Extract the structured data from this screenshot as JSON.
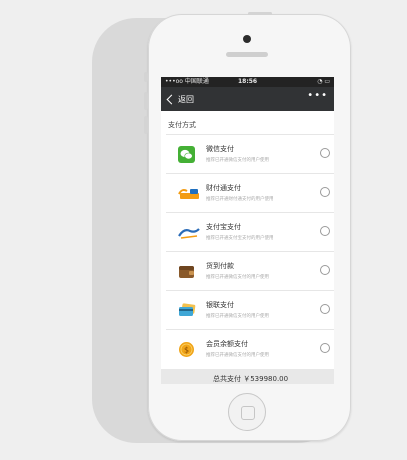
{
  "status_bar": {
    "carrier": "•••oo 中国联通",
    "time": "18:56",
    "indicators": "◔ ▭"
  },
  "nav": {
    "back_label": "返回",
    "more_label": "•••"
  },
  "section_title": "支付方式",
  "payment_methods": [
    {
      "title": "微信支付",
      "description": "推荐已开通微信支付的用户使用",
      "icon": "wechat-pay-icon",
      "color": "#44b035"
    },
    {
      "title": "财付通支付",
      "description": "推荐已开通财付通支付的用户使用",
      "icon": "tenpay-icon",
      "color": "#f39c12"
    },
    {
      "title": "支付宝支付",
      "description": "推荐已开通支付宝支付的用户使用",
      "icon": "alipay-icon",
      "color": "#2a6bb7"
    },
    {
      "title": "货到付款",
      "description": "推荐已开通微信支付的用户使用",
      "icon": "wallet-icon",
      "color": "#8a5a2b"
    },
    {
      "title": "银联支付",
      "description": "推荐已开通微信支付的用户使用",
      "icon": "bank-card-icon",
      "color": "#3fa7d6"
    },
    {
      "title": "会员余额支付",
      "description": "推荐已开通微信支付的用户使用",
      "icon": "coin-icon",
      "color": "#f0a418"
    }
  ],
  "total": {
    "label": "总共支付 ￥539980.00"
  }
}
